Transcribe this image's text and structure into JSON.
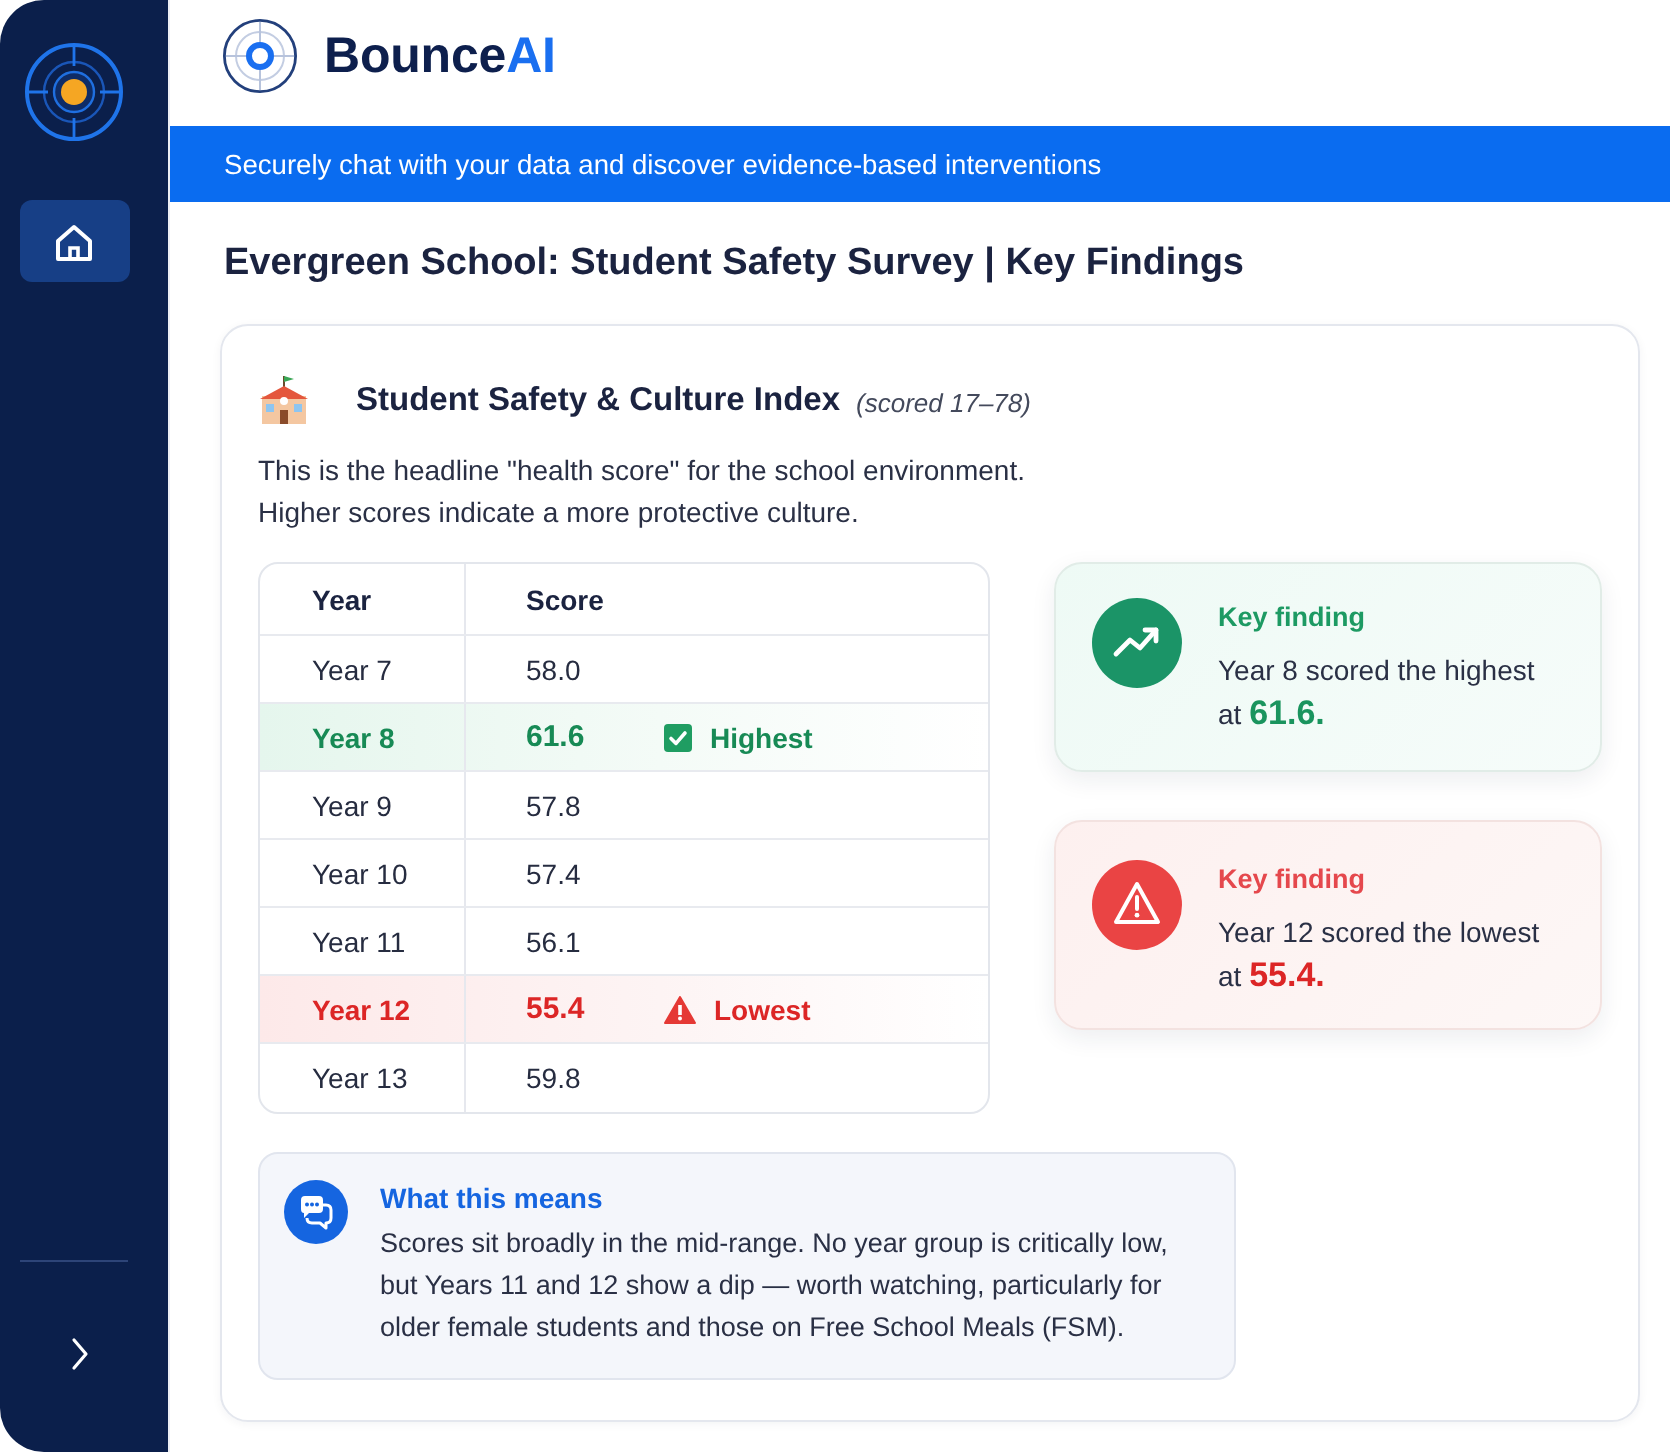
{
  "sidebar": {
    "nav_items": [
      {
        "kind": "home",
        "selected": true
      }
    ]
  },
  "header": {
    "brand": {
      "name": "Bounce",
      "accent": "AI"
    }
  },
  "banner": {
    "text": "Securely chat with your data and discover evidence-based interventions"
  },
  "page_title": "Evergreen School: Student Safety Survey | Key Findings",
  "index_card": {
    "title": "Student Safety & Culture Index",
    "range_note": "(scored 17–78)",
    "description": [
      "This is the headline \"health score\" for the school environment.",
      "Higher scores indicate a more protective culture."
    ],
    "table": {
      "columns": [
        "Year",
        "Score"
      ],
      "rows": [
        {
          "kind": "plain",
          "year": "Year 7",
          "score": "58.0"
        },
        {
          "kind": "highest",
          "year": "Year 8",
          "score": "61.6",
          "badge": "Highest"
        },
        {
          "kind": "plain",
          "year": "Year 9",
          "score": "57.8"
        },
        {
          "kind": "plain",
          "year": "Year 10",
          "score": "57.4"
        },
        {
          "kind": "plain",
          "year": "Year 11",
          "score": "56.1"
        },
        {
          "kind": "lowest",
          "year": "Year 12",
          "score": "55.4",
          "badge": "Lowest"
        },
        {
          "kind": "plain",
          "year": "Year 13",
          "score": "59.8"
        }
      ]
    },
    "findings": [
      {
        "kind": "high",
        "label": "Key finding",
        "text": "Year 8 scored the highest at **61.6.**"
      },
      {
        "kind": "low",
        "label": "Key finding",
        "text": "Year 12 scored the lowest at **55.4.**"
      }
    ],
    "note": {
      "title": "What this means",
      "text": "Scores sit broadly in the mid-range. No year group is critically low, but Years 11 and 12 show a dip — worth watching, particularly for older female students and those on Free School Meals (FSM)."
    }
  }
}
